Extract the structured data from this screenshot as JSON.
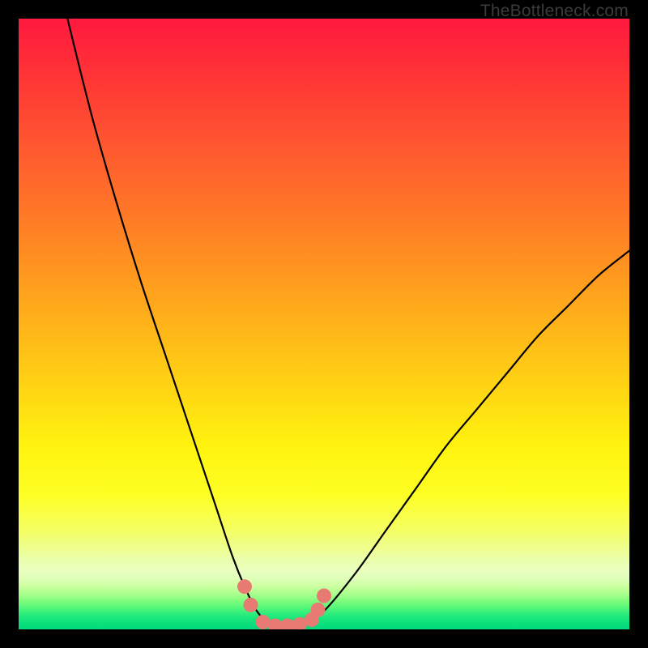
{
  "watermark": "TheBottleneck.com",
  "chart_data": {
    "type": "line",
    "title": "",
    "xlabel": "",
    "ylabel": "",
    "xlim": [
      0,
      100
    ],
    "ylim": [
      0,
      100
    ],
    "series": [
      {
        "name": "bottleneck-curve",
        "x": [
          8,
          12,
          16,
          20,
          24,
          28,
          32,
          35,
          37,
          39,
          41,
          43,
          45,
          47,
          50,
          55,
          60,
          65,
          70,
          75,
          80,
          85,
          90,
          95,
          100
        ],
        "y": [
          100,
          84,
          70,
          57,
          45,
          33,
          21,
          12,
          7,
          3,
          1,
          0.5,
          0.5,
          1,
          3,
          9,
          16,
          23,
          30,
          36,
          42,
          48,
          53,
          58,
          62
        ]
      }
    ],
    "markers": {
      "name": "highlight-dots",
      "color": "#e77b74",
      "points": [
        {
          "x": 37,
          "y": 7
        },
        {
          "x": 38,
          "y": 4
        },
        {
          "x": 40,
          "y": 1.2
        },
        {
          "x": 42,
          "y": 0.6
        },
        {
          "x": 44,
          "y": 0.6
        },
        {
          "x": 46,
          "y": 0.8
        },
        {
          "x": 48,
          "y": 1.6
        },
        {
          "x": 49,
          "y": 3.2
        },
        {
          "x": 50,
          "y": 5.5
        }
      ]
    },
    "background": {
      "type": "vertical-gradient",
      "stops": [
        {
          "pos": 0.0,
          "color": "#ff193f"
        },
        {
          "pos": 0.1,
          "color": "#ff3635"
        },
        {
          "pos": 0.2,
          "color": "#ff5530"
        },
        {
          "pos": 0.3,
          "color": "#ff7228"
        },
        {
          "pos": 0.4,
          "color": "#ff9220"
        },
        {
          "pos": 0.5,
          "color": "#ffb319"
        },
        {
          "pos": 0.6,
          "color": "#ffd314"
        },
        {
          "pos": 0.7,
          "color": "#fff30e"
        },
        {
          "pos": 0.78,
          "color": "#feff24"
        },
        {
          "pos": 0.84,
          "color": "#f4ff66"
        },
        {
          "pos": 0.885,
          "color": "#eaffab"
        },
        {
          "pos": 0.905,
          "color": "#e9ffc0"
        },
        {
          "pos": 0.918,
          "color": "#deffb6"
        },
        {
          "pos": 0.93,
          "color": "#caff9f"
        },
        {
          "pos": 0.942,
          "color": "#aaff8e"
        },
        {
          "pos": 0.952,
          "color": "#86fd7f"
        },
        {
          "pos": 0.962,
          "color": "#5ef87a"
        },
        {
          "pos": 0.972,
          "color": "#37f07b"
        },
        {
          "pos": 0.982,
          "color": "#17e67c"
        },
        {
          "pos": 1.0,
          "color": "#00d97c"
        }
      ]
    }
  }
}
